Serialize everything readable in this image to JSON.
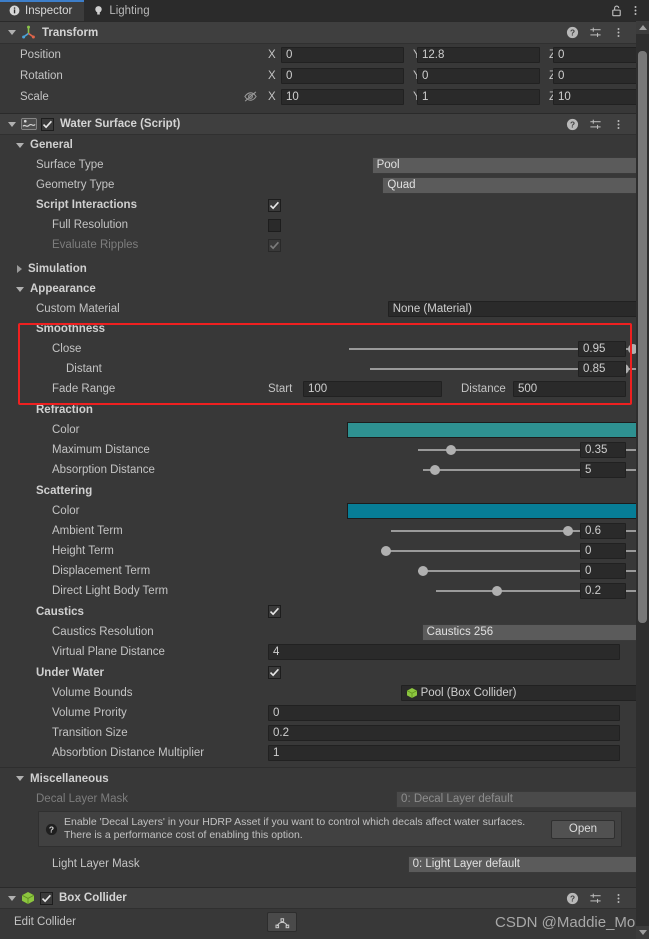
{
  "window": {
    "tabs": [
      {
        "label": "Inspector",
        "icon": "info-icon",
        "active": true
      },
      {
        "label": "Lighting",
        "icon": "lightbulb-icon",
        "active": false
      }
    ],
    "lock_icon": "lock-open-icon",
    "menu_icon": "kebab-menu-icon"
  },
  "header_icons": {
    "help": "help-icon",
    "preset": "preset-settings-icon",
    "menu": "kebab-menu-icon"
  },
  "transform": {
    "title": "Transform",
    "icon": "transform-gizmo-icon",
    "rows": [
      {
        "label": "Position",
        "x": "0",
        "y": "12.8",
        "z": "0",
        "has_link": false
      },
      {
        "label": "Rotation",
        "x": "0",
        "y": "0",
        "z": "0",
        "has_link": false
      },
      {
        "label": "Scale",
        "x": "10",
        "y": "1",
        "z": "10",
        "has_link": true,
        "link_icon": "eye-off-icon"
      }
    ],
    "axis_labels": {
      "x": "X",
      "y": "Y",
      "z": "Z"
    }
  },
  "water_surface": {
    "title": "Water Surface (Script)",
    "icon": "script-icon",
    "enabled": true,
    "general": {
      "title": "General",
      "surface_type": {
        "label": "Surface Type",
        "value": "Pool"
      },
      "geometry_type": {
        "label": "Geometry Type",
        "value": "Quad"
      },
      "script_interactions": {
        "label": "Script Interactions",
        "checked": true
      },
      "full_resolution": {
        "label": "Full Resolution",
        "checked": false
      },
      "evaluate_ripples": {
        "label": "Evaluate Ripples",
        "checked": true,
        "disabled": true
      }
    },
    "simulation": {
      "title": "Simulation",
      "expanded": false
    },
    "appearance": {
      "title": "Appearance",
      "custom_material": {
        "label": "Custom Material",
        "value": "None (Material)"
      },
      "smoothness": {
        "title": "Smoothness",
        "close": {
          "label": "Close",
          "value": "0.95",
          "slider_pct": 95
        },
        "distant": {
          "label": "Distant",
          "value": "0.85",
          "slider_pct": 85
        },
        "fade_range": {
          "label": "Fade Range",
          "start_label": "Start",
          "start_value": "100",
          "distance_label": "Distance",
          "distance_value": "500"
        }
      },
      "refraction": {
        "title": "Refraction",
        "color": {
          "label": "Color",
          "value": "#2E9191"
        },
        "maximum_distance": {
          "label": "Maximum Distance",
          "value": "0.35",
          "slider_pct": 11
        },
        "absorption_distance": {
          "label": "Absorption Distance",
          "value": "5",
          "slider_pct": 4
        }
      },
      "scattering": {
        "title": "Scattering",
        "color": {
          "label": "Color",
          "value": "#077D96"
        },
        "ambient_term": {
          "label": "Ambient Term",
          "value": "0.6",
          "slider_pct": 58
        },
        "height_term": {
          "label": "Height Term",
          "value": "0",
          "slider_pct": 1
        },
        "displacement_term": {
          "label": "Displacement Term",
          "value": "0",
          "slider_pct": 1
        },
        "direct_light_body_term": {
          "label": "Direct Light Body Term",
          "value": "0.2",
          "slider_pct": 20
        }
      },
      "caustics": {
        "title": "Caustics",
        "checked": true,
        "resolution": {
          "label": "Caustics Resolution",
          "value": "Caustics 256"
        },
        "virtual_plane_distance": {
          "label": "Virtual Plane Distance",
          "value": "4"
        }
      },
      "under_water": {
        "title": "Under Water",
        "checked": true,
        "volume_bounds": {
          "label": "Volume Bounds",
          "value": "Pool (Box Collider)",
          "icon": "box-collider-icon"
        },
        "volume_priority": {
          "label": "Volume Prority",
          "value": "0"
        },
        "transition_size": {
          "label": "Transition Size",
          "value": "0.2"
        },
        "absorption_multiplier": {
          "label": "Absorbtion Distance Multiplier",
          "value": "1"
        }
      }
    },
    "miscellaneous": {
      "title": "Miscellaneous",
      "decal_layer_mask": {
        "label": "Decal Layer Mask",
        "value": "0: Decal Layer default",
        "disabled": true
      },
      "help": {
        "line1": "Enable 'Decal Layers' in your HDRP Asset if you want to control which decals affect water surfaces.",
        "line2": "There is a performance cost of enabling this option.",
        "button": "Open",
        "icon": "help-circle-icon"
      },
      "light_layer_mask": {
        "label": "Light Layer Mask",
        "value": "0: Light Layer default"
      }
    }
  },
  "box_collider": {
    "title": "Box Collider",
    "icon": "box-collider-icon",
    "enabled": true,
    "edit_collider": {
      "label": "Edit Collider",
      "button_icon": "edit-collider-icon"
    }
  },
  "watermark": "CSDN @Maddie_Mo",
  "colors": {
    "accent_tab": "#3D7EC9",
    "highlight_box": "#EF2020",
    "panel_bg": "#383838",
    "header_bg": "#3F3F3F"
  }
}
